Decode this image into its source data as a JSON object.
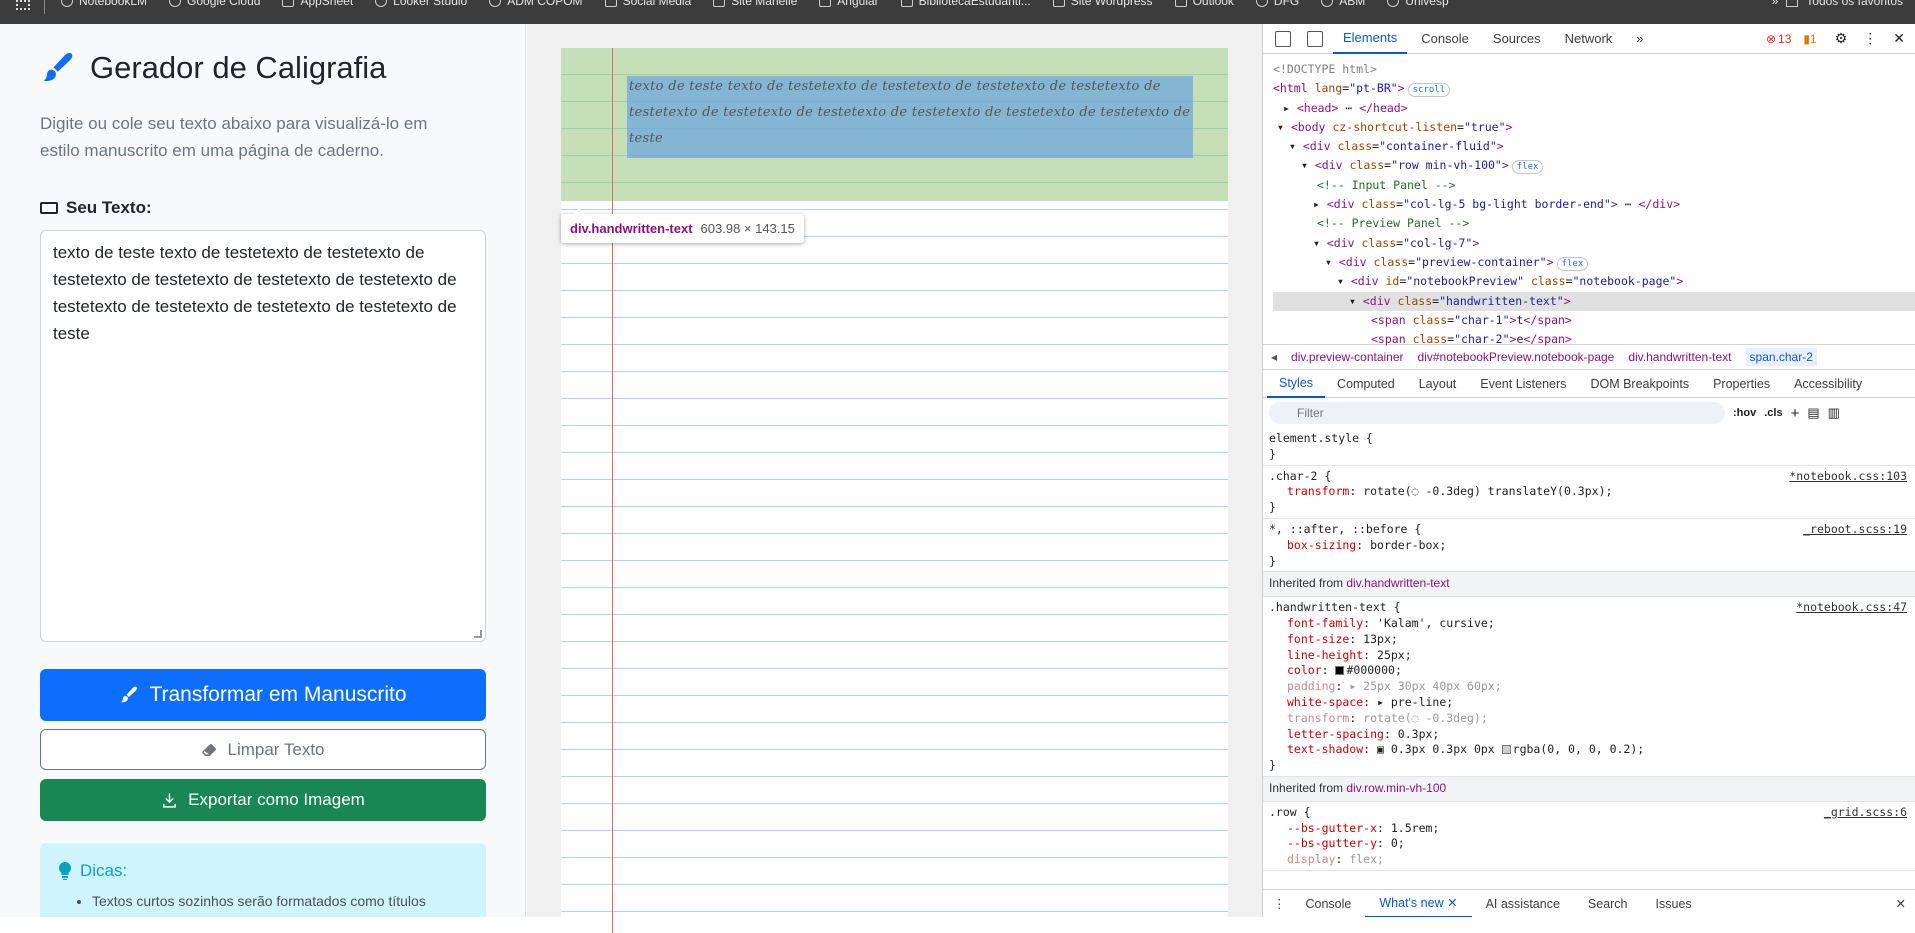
{
  "bookmarks": {
    "items": [
      "NotebookLM",
      "Google Cloud",
      "AppSheet",
      "Looker Studio",
      "ADM COPOM",
      "Social Media",
      "Site Marielle",
      "Angular",
      "BibliotecaEstudanti...",
      "Site Wordpress",
      "Outlook",
      "DFG",
      "ABM",
      "Univesp"
    ],
    "all_label": "Todos os favoritos"
  },
  "app": {
    "title": "Gerador de Caligrafia",
    "subtitle": "Digite ou cole seu texto abaixo para visualizá-lo em estilo manuscrito em uma página de caderno.",
    "input_label": "Seu Texto:",
    "input_value": "texto de teste texto de testetexto de testetexto de testetexto de testetexto de testetexto de testetexto de testetexto de testetexto de testetexto de testetexto de teste",
    "transform_button": "Transformar em Manuscrito",
    "clear_button": "Limpar Texto",
    "export_button": "Exportar como Imagem",
    "tips_title": "Dicas:",
    "tips": [
      "Textos curtos sozinhos serão formatados como títulos"
    ]
  },
  "preview": {
    "handwritten": "texto de teste texto de testetexto de testetexto de testetexto de testetexto de testetexto de testetexto de testetexto de testetexto de testetexto de testetexto de teste",
    "tooltip_selector": "div.handwritten-text",
    "tooltip_size": "603.98 × 143.15"
  },
  "devtools": {
    "tabs": [
      "Elements",
      "Console",
      "Sources",
      "Network"
    ],
    "errors": "13",
    "warnings": "1",
    "breadcrumbs": [
      "div.preview-container",
      "div#notebookPreview.notebook-page",
      "div.handwritten-text",
      "span.char-2"
    ],
    "subtabs": [
      "Styles",
      "Computed",
      "Layout",
      "Event Listeners",
      "DOM Breakpoints",
      "Properties",
      "Accessibility"
    ],
    "filter_placeholder": "Filter",
    "hov": ":hov",
    "cls": ".cls",
    "inherited1": "Inherited from ",
    "inherited1_sel": "div.handwritten-text",
    "inherited2": "Inherited from ",
    "inherited2_sel": "div.row.min-vh-100",
    "drawer_tabs": [
      "Console",
      "What's new",
      "AI assistance",
      "Search",
      "Issues"
    ]
  }
}
